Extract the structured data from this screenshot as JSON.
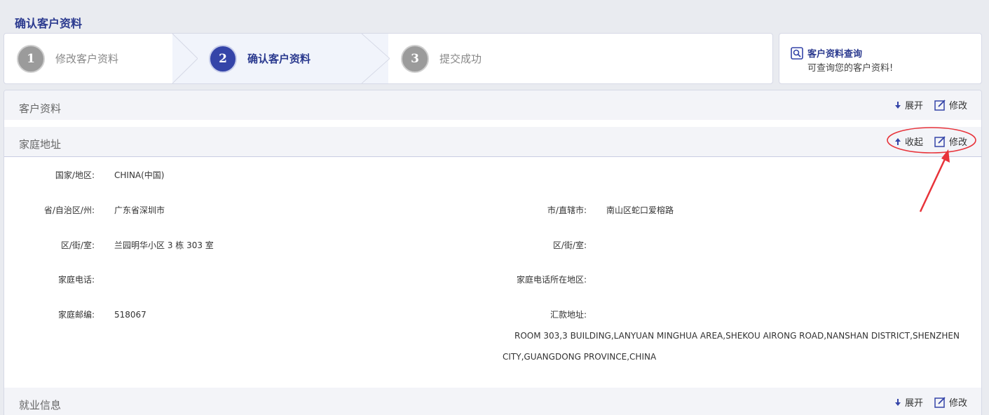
{
  "page": {
    "title": "确认客户资料"
  },
  "steps": [
    {
      "number": "1",
      "label": "修改客户资料"
    },
    {
      "number": "2",
      "label": "确认客户资料"
    },
    {
      "number": "3",
      "label": "提交成功"
    }
  ],
  "query": {
    "title": "客户资料查询",
    "subtitle": "可查询您的客户资料!"
  },
  "sections": {
    "customer": {
      "title": "客户资料",
      "expand": "展开",
      "edit": "修改"
    },
    "home_address": {
      "title": "家庭地址",
      "collapse": "收起",
      "edit": "修改"
    },
    "employment": {
      "title": "就业信息",
      "expand": "展开",
      "edit": "修改"
    }
  },
  "home_address_fields": {
    "country_label": "国家/地区:",
    "country_value": "CHINA(中国)",
    "province_label": "省/自治区/州:",
    "province_value": "广东省深圳市",
    "city_label": "市/直辖市:",
    "city_value": "南山区蛇口爱榕路",
    "district_label": "区/街/室:",
    "district_value": "兰园明华小区 3 栋 303 室",
    "district2_label": "区/街/室:",
    "district2_value": "",
    "home_phone_label": "家庭电话:",
    "home_phone_value": "",
    "home_phone_region_label": "家庭电话所在地区:",
    "home_phone_region_value": "",
    "postcode_label": "家庭邮编:",
    "postcode_value": "518067",
    "remit_label": "汇款地址:",
    "remit_line1": "ROOM 303,3 BUILDING,LANYUAN MINGHUA AREA,SHEKOU AIRONG ROAD,NANSHAN DISTRICT,SHENZHEN",
    "remit_line2": "CITY,GUANGDONG PROVINCE,CHINA"
  },
  "colors": {
    "accent": "#3444a8",
    "title": "#2b3a8f",
    "annotation": "#e8333a"
  }
}
